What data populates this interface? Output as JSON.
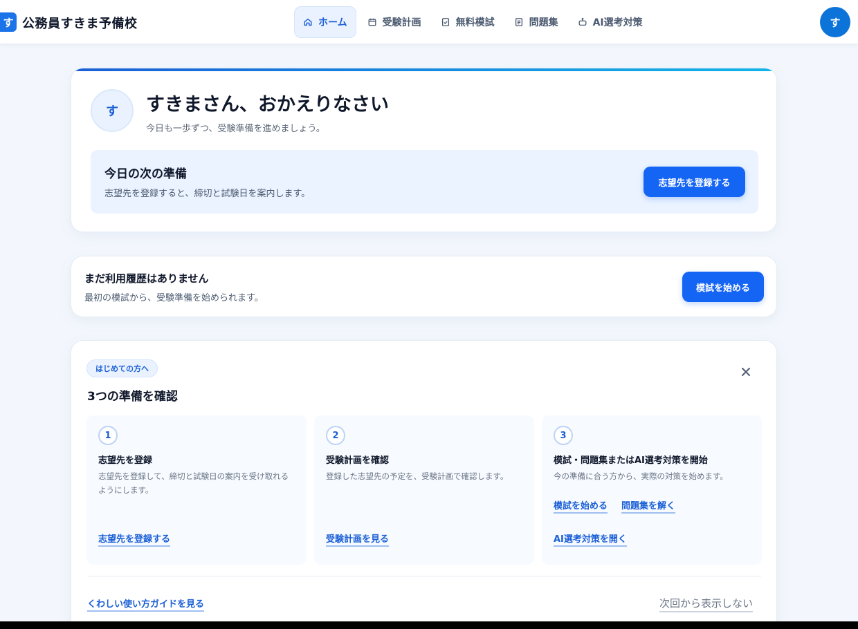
{
  "header": {
    "logo_mark": "す",
    "logo_text": "公務員すきま予備校",
    "nav": [
      {
        "label": "ホーム",
        "icon": "home-icon",
        "active": true
      },
      {
        "label": "受験計画",
        "icon": "calendar-icon"
      },
      {
        "label": "無料模試",
        "icon": "checklist-icon"
      },
      {
        "label": "問題集",
        "icon": "document-icon"
      },
      {
        "label": "AI選考対策",
        "icon": "robot-icon"
      }
    ],
    "avatar": "す"
  },
  "welcome": {
    "avatar": "す",
    "title": "すきまさん、おかえりなさい",
    "subtitle": "今日も一歩ずつ、受験準備を進めましょう。",
    "next": {
      "title": "今日の次の準備",
      "description": "志望先を登録すると、締切と試験日を案内します。",
      "button": "志望先を登録する"
    }
  },
  "history": {
    "title": "まだ利用履歴はありません",
    "description": "最初の模試から、受験準備を始められます。",
    "button": "模試を始める"
  },
  "guide": {
    "badge": "はじめての方へ",
    "title": "3つの準備を確認",
    "steps": [
      {
        "num": "1",
        "title": "志望先を登録",
        "description": "志望先を登録して、締切と試験日の案内を受け取れるようにします。",
        "links": [
          "志望先を登録する"
        ]
      },
      {
        "num": "2",
        "title": "受験計画を確認",
        "description": "登録した志望先の予定を、受験計画で確認します。",
        "links": [
          "受験計画を見る"
        ]
      },
      {
        "num": "3",
        "title": "模試・問題集またはAI選考対策を開始",
        "description": "今の準備に合う方から、実際の対策を始めます。",
        "links": [
          "模試を始める",
          "問題集を解く",
          "AI選考対策を開く"
        ]
      }
    ],
    "footer_link": "くわしい使い方ガイドを見る",
    "hide_link": "次回から表示しない"
  },
  "colors": {
    "accent": "#1565f5",
    "accent_text": "#1a5fd6",
    "background": "#f3f7fd"
  }
}
